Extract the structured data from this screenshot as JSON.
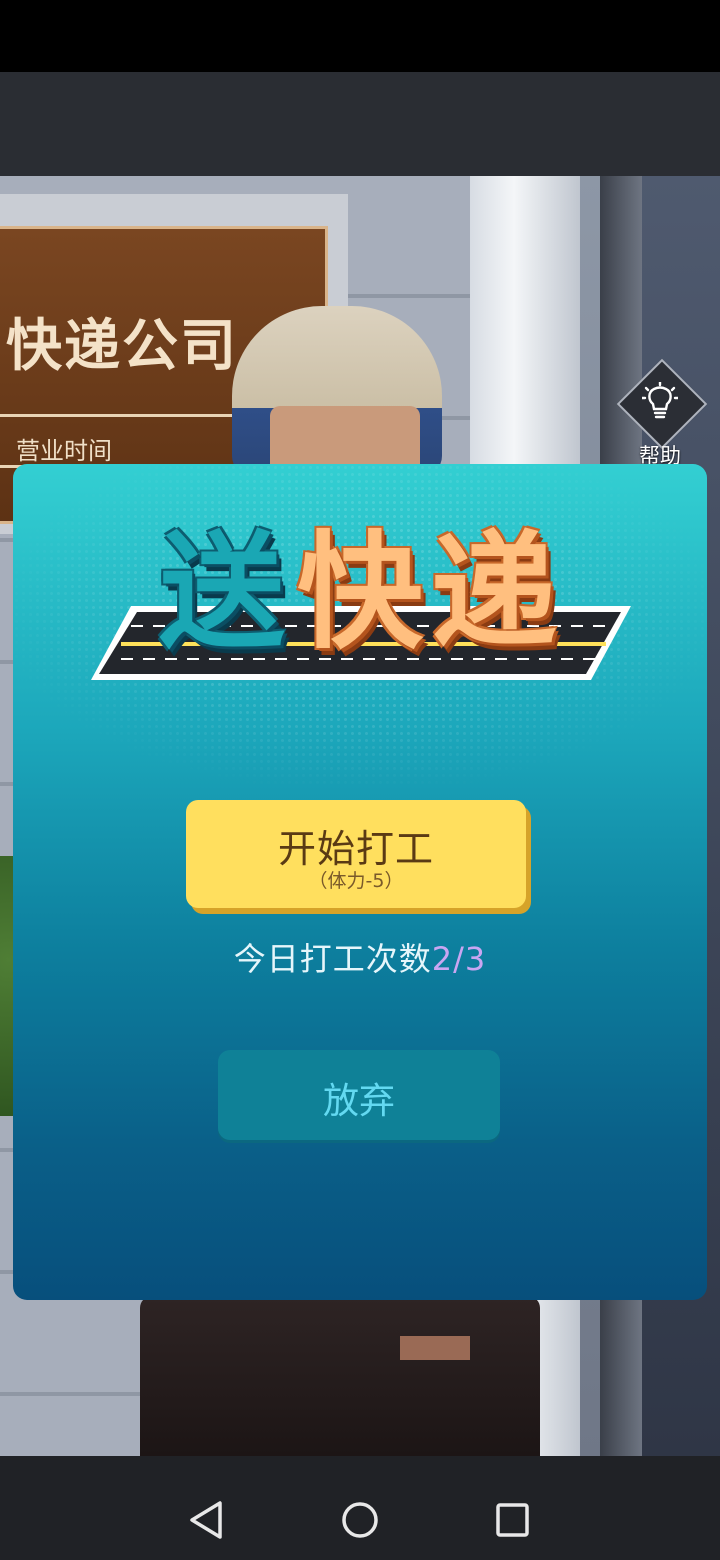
{
  "background": {
    "sign_title": "快递公司",
    "sign_subtitle": "营业时间",
    "sign_dots": "ooooo"
  },
  "help": {
    "icon": "lightbulb-icon",
    "label": "帮助"
  },
  "dialog": {
    "title_chars": [
      "送",
      "快",
      "递"
    ],
    "start_button": {
      "label": "开始打工",
      "sublabel": "（体力-5）"
    },
    "attempts": {
      "label": "今日打工次数",
      "count": "2/3"
    },
    "give_up_label": "放弃"
  },
  "nav": {
    "back_icon": "back-triangle-icon",
    "home_icon": "home-circle-icon",
    "recents_icon": "recents-square-icon"
  },
  "colors": {
    "start_button": "#ffdf5e",
    "dialog_top": "#33cfd2",
    "dialog_bottom": "#074f7c",
    "attempts_count": "#c9a6f2"
  }
}
